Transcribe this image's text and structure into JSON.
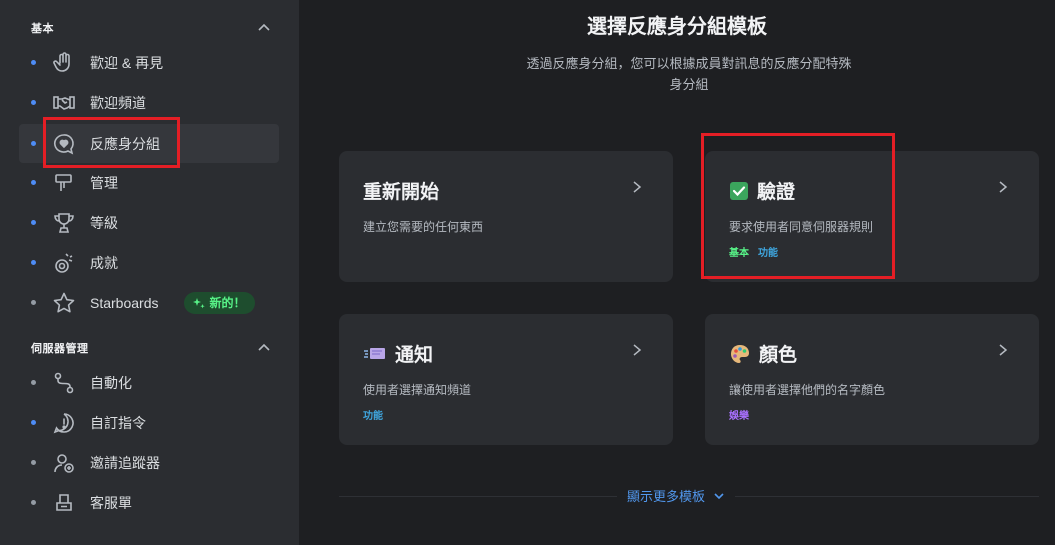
{
  "sidebar": {
    "sections": [
      {
        "title": "基本"
      },
      {
        "title": "伺服器管理"
      }
    ],
    "items": [
      {
        "label": "歡迎 & 再見",
        "icon": "wave-hand-icon"
      },
      {
        "label": "歡迎頻道",
        "icon": "handshake-icon"
      },
      {
        "label": "反應身分組",
        "icon": "reaction-heart-icon"
      },
      {
        "label": "管理",
        "icon": "gavel-icon"
      },
      {
        "label": "等級",
        "icon": "trophy-icon"
      },
      {
        "label": "成就",
        "icon": "achievement-icon"
      },
      {
        "label": "Starboards",
        "icon": "star-icon",
        "badge": "新的！"
      },
      {
        "label": "自動化",
        "icon": "automation-icon"
      },
      {
        "label": "自訂指令",
        "icon": "custom-command-icon"
      },
      {
        "label": "邀請追蹤器",
        "icon": "invite-tracker-icon"
      },
      {
        "label": "客服單",
        "icon": "ticket-icon"
      }
    ]
  },
  "main": {
    "title": "選擇反應身分組模板",
    "subtitle_line1": "透過反應身分組，您可以根據成員對訊息的反應分配特殊",
    "subtitle_line2": "身分組",
    "cards": [
      {
        "title": "重新開始",
        "description": "建立您需要的任何東西",
        "tags": []
      },
      {
        "title": "驗證",
        "description": "要求使用者同意伺服器規則",
        "tags": [
          "基本",
          "功能"
        ],
        "icon": "check-box-icon"
      },
      {
        "title": "通知",
        "description": "使用者選擇通知頻道",
        "tags": [
          "功能"
        ],
        "icon": "notification-icon"
      },
      {
        "title": "顏色",
        "description": "讓使用者選擇他們的名字顏色",
        "tags": [
          "娛樂"
        ],
        "icon": "palette-icon"
      }
    ],
    "show_more": "顯示更多模板"
  },
  "colors": {
    "accent_blue": "#4e8cf5",
    "highlight_red": "#e41e25",
    "tag_green": "#57f287",
    "tag_blue": "#3fa7e0",
    "tag_purple": "#a970ff"
  }
}
